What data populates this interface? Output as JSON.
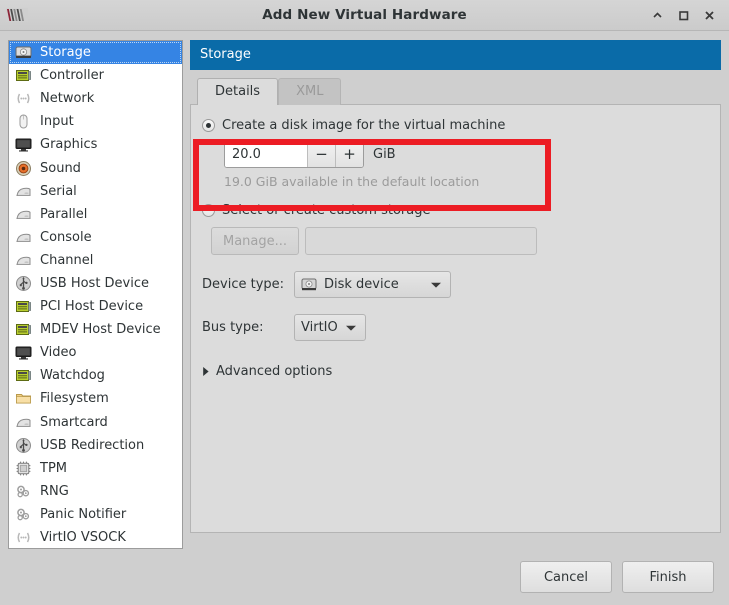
{
  "window": {
    "title": "Add New Virtual Hardware",
    "app_icon": "virt-manager-icon",
    "controls": {
      "minimize": "minimize-icon",
      "maximize": "maximize-icon",
      "close": "close-icon"
    }
  },
  "sidebar": {
    "items": [
      {
        "label": "Storage",
        "icon": "disk-icon",
        "selected": true
      },
      {
        "label": "Controller",
        "icon": "card-icon",
        "selected": false
      },
      {
        "label": "Network",
        "icon": "network-icon",
        "selected": false
      },
      {
        "label": "Input",
        "icon": "mouse-icon",
        "selected": false
      },
      {
        "label": "Graphics",
        "icon": "monitor-icon",
        "selected": false
      },
      {
        "label": "Sound",
        "icon": "speaker-icon",
        "selected": false
      },
      {
        "label": "Serial",
        "icon": "serial-icon",
        "selected": false
      },
      {
        "label": "Parallel",
        "icon": "serial-icon",
        "selected": false
      },
      {
        "label": "Console",
        "icon": "serial-icon",
        "selected": false
      },
      {
        "label": "Channel",
        "icon": "serial-icon",
        "selected": false
      },
      {
        "label": "USB Host Device",
        "icon": "usb-icon",
        "selected": false
      },
      {
        "label": "PCI Host Device",
        "icon": "card-icon",
        "selected": false
      },
      {
        "label": "MDEV Host Device",
        "icon": "card-icon",
        "selected": false
      },
      {
        "label": "Video",
        "icon": "monitor-icon",
        "selected": false
      },
      {
        "label": "Watchdog",
        "icon": "card-icon",
        "selected": false
      },
      {
        "label": "Filesystem",
        "icon": "folder-icon",
        "selected": false
      },
      {
        "label": "Smartcard",
        "icon": "serial-icon",
        "selected": false
      },
      {
        "label": "USB Redirection",
        "icon": "usb-icon",
        "selected": false
      },
      {
        "label": "TPM",
        "icon": "chip-icon",
        "selected": false
      },
      {
        "label": "RNG",
        "icon": "gears-icon",
        "selected": false
      },
      {
        "label": "Panic Notifier",
        "icon": "gears-icon",
        "selected": false
      },
      {
        "label": "VirtIO VSOCK",
        "icon": "network-icon",
        "selected": false
      }
    ]
  },
  "content": {
    "section_title": "Storage",
    "tabs": [
      {
        "label": "Details",
        "active": true
      },
      {
        "label": "XML",
        "active": false
      }
    ],
    "create_disk": {
      "radio_label": "Create a disk image for the virtual machine",
      "selected": true,
      "size_value": "20.0",
      "decrement_label": "−",
      "increment_label": "+",
      "unit": "GiB",
      "available_note": "19.0 GiB available in the default location"
    },
    "custom_storage": {
      "radio_label": "Select or create custom storage",
      "selected": false,
      "manage_label": "Manage...",
      "path_value": "",
      "path_placeholder": ""
    },
    "device_type": {
      "label": "Device type:",
      "value": "Disk device",
      "icon": "disk-icon"
    },
    "bus_type": {
      "label": "Bus type:",
      "value": "VirtIO"
    },
    "advanced": {
      "label": "Advanced options",
      "expanded": false
    }
  },
  "footer": {
    "cancel_label": "Cancel",
    "finish_label": "Finish"
  },
  "highlight": {
    "color": "#ec1c24"
  }
}
